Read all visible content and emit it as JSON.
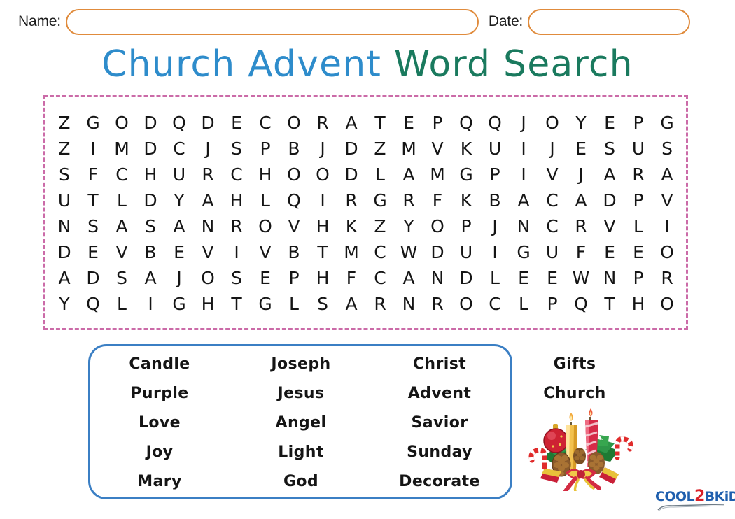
{
  "header": {
    "name_label": "Name:",
    "name_value": "",
    "name_placeholder": "",
    "date_label": "Date:",
    "date_value": "",
    "date_placeholder": "",
    "field_border_color": "#E08B3C"
  },
  "title": {
    "part_a": "Church Advent",
    "part_b": "Word Search",
    "part_a_color": "#2E8CCB",
    "part_b_color": "#1A7A5E"
  },
  "puzzle": {
    "border_color": "#CB6BA8",
    "rows": 8,
    "cols": 21,
    "grid": [
      [
        "Z",
        "G",
        "O",
        "D",
        "Q",
        "D",
        "E",
        "C",
        "O",
        "R",
        "A",
        "T",
        "E",
        "P",
        "Q",
        "Q",
        "J",
        "O",
        "Y",
        "E",
        "P",
        "G"
      ],
      [
        "Z",
        "I",
        "M",
        "D",
        "C",
        "J",
        "S",
        "P",
        "B",
        "J",
        "D",
        "Z",
        "M",
        "V",
        "K",
        "U",
        "I",
        "J",
        "E",
        "S",
        "U",
        "S"
      ],
      [
        "S",
        "F",
        "C",
        "H",
        "U",
        "R",
        "C",
        "H",
        "O",
        "O",
        "D",
        "L",
        "A",
        "M",
        "G",
        "P",
        "I",
        "V",
        "J",
        "A",
        "R",
        "A"
      ],
      [
        "U",
        "T",
        "L",
        "D",
        "Y",
        "A",
        "H",
        "L",
        "Q",
        "I",
        "R",
        "G",
        "R",
        "F",
        "K",
        "B",
        "A",
        "C",
        "A",
        "D",
        "P",
        "V"
      ],
      [
        "N",
        "S",
        "A",
        "S",
        "A",
        "N",
        "R",
        "O",
        "V",
        "H",
        "K",
        "Z",
        "Y",
        "O",
        "P",
        "J",
        "N",
        "C",
        "R",
        "V",
        "L",
        "I"
      ],
      [
        "D",
        "E",
        "V",
        "B",
        "E",
        "V",
        "I",
        "V",
        "B",
        "T",
        "M",
        "C",
        "W",
        "D",
        "U",
        "I",
        "G",
        "U",
        "F",
        "E",
        "E",
        "O"
      ],
      [
        "A",
        "D",
        "S",
        "A",
        "J",
        "O",
        "S",
        "E",
        "P",
        "H",
        "F",
        "C",
        "A",
        "N",
        "D",
        "L",
        "E",
        "E",
        "W",
        "N",
        "P",
        "R"
      ],
      [
        "Y",
        "Q",
        "L",
        "I",
        "G",
        "H",
        "T",
        "G",
        "L",
        "S",
        "A",
        "R",
        "N",
        "R",
        "O",
        "C",
        "L",
        "P",
        "Q",
        "T",
        "H",
        "O"
      ]
    ]
  },
  "wordlist": {
    "border_color": "#3B7FC4",
    "columns": [
      [
        "Candle",
        "Purple",
        "Love",
        "Joy",
        "Mary"
      ],
      [
        "Joseph",
        "Jesus",
        "Angel",
        "Light",
        "God"
      ],
      [
        "Christ",
        "Advent",
        "Savior",
        "Sunday",
        "Decorate"
      ],
      [
        "Gifts",
        "Church"
      ]
    ]
  },
  "decoration": {
    "name": "christmas-candle-ornament-arrangement",
    "elements": [
      "red-candle",
      "gold-candle",
      "red-ornament-ball",
      "pinecone",
      "pine-branch",
      "candy-cane",
      "ribbon-bow"
    ]
  },
  "logo": {
    "part_1": "COOL",
    "part_2": "2",
    "part_3": "BKiDS",
    "blue": "#1F5FAE",
    "red": "#D92027"
  }
}
